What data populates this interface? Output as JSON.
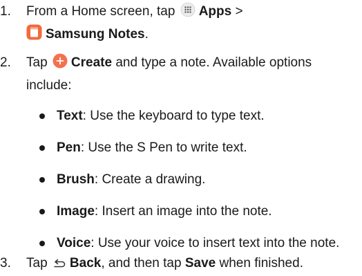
{
  "steps": [
    {
      "number": "1.",
      "pre": "From a Home screen, tap",
      "apps_label": "Apps",
      "separator": ">",
      "notes_label": "Samsung Notes",
      "post": "."
    },
    {
      "number": "2.",
      "pre": "Tap",
      "create_label": "Create",
      "post": "and type a note. Available options include:"
    },
    {
      "number": "3.",
      "pre": "Tap",
      "back_label": "Back",
      "mid": ", and then tap",
      "save_label": "Save",
      "post": "when finished."
    }
  ],
  "options": [
    {
      "term": "Text",
      "desc": ": Use the keyboard to type text."
    },
    {
      "term": "Pen",
      "desc": ": Use the S Pen to write text."
    },
    {
      "term": "Brush",
      "desc": ": Create a drawing."
    },
    {
      "term": "Image",
      "desc": ": Insert an image into the note."
    },
    {
      "term": "Voice",
      "desc": ": Use your voice to insert text into the note."
    }
  ],
  "icons": {
    "apps": "apps-grid-icon",
    "notes": "samsung-notes-icon",
    "create": "create-plus-icon",
    "back": "back-arrow-icon"
  },
  "colors": {
    "notes_orange": "#f26a3b",
    "create_orange": "#f4714f"
  }
}
